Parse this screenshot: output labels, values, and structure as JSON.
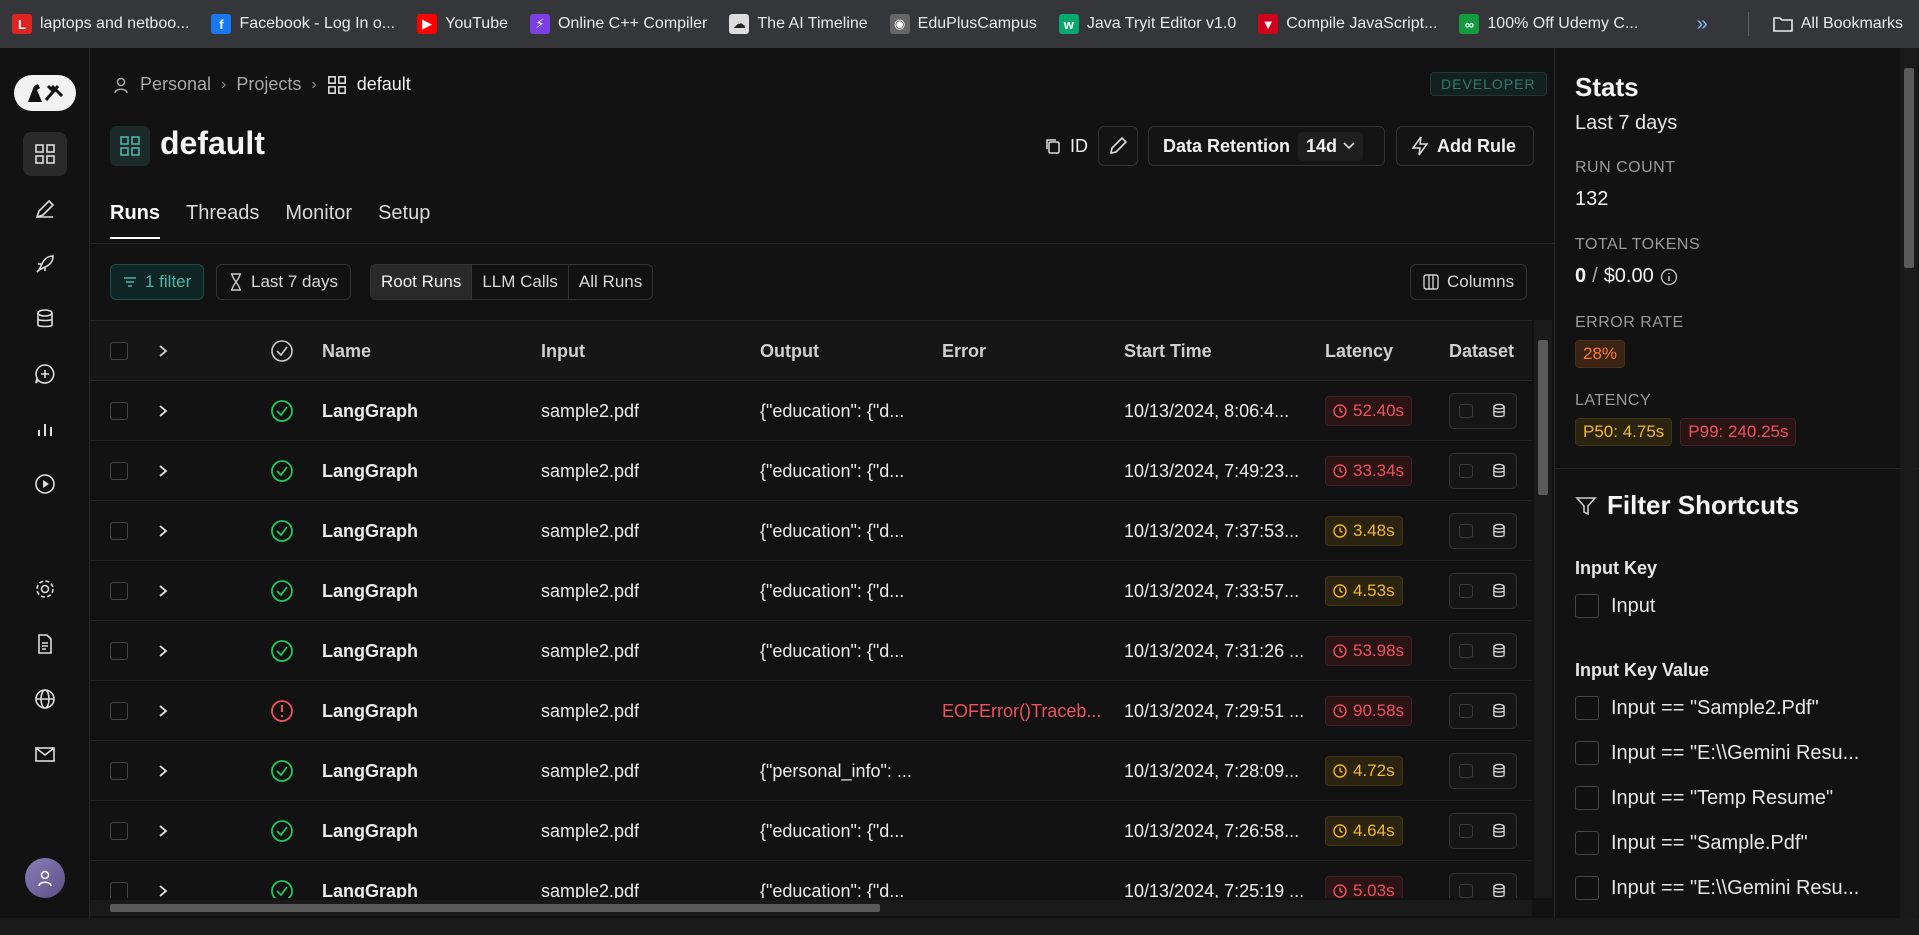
{
  "bookmarks": [
    {
      "label": "laptops and netboo...",
      "color": "#e02424",
      "glyph": "L"
    },
    {
      "label": "Facebook - Log In o...",
      "color": "#1877f2",
      "glyph": "f"
    },
    {
      "label": "YouTube",
      "color": "#ff0000",
      "glyph": "▶"
    },
    {
      "label": "Online C++ Compiler",
      "color": "#7b3fe4",
      "glyph": "⚡"
    },
    {
      "label": "The AI Timeline",
      "color": "#dddddd",
      "glyph": "☁"
    },
    {
      "label": "EduPlusCampus",
      "color": "#666666",
      "glyph": "◉"
    },
    {
      "label": "Java Tryit Editor v1.0",
      "color": "#04aa6d",
      "glyph": "w"
    },
    {
      "label": "Compile JavaScript...",
      "color": "#d0021b",
      "glyph": "▼"
    },
    {
      "label": "100% Off Udemy C...",
      "color": "#129c3e",
      "glyph": "∞"
    }
  ],
  "bookmarks_more": "»",
  "all_bookmarks": "All Bookmarks",
  "breadcrumb": {
    "personal": "Personal",
    "projects": "Projects",
    "current": "default"
  },
  "env_badge": "DEVELOPER",
  "project": {
    "title": "default"
  },
  "toolbar": {
    "id_label": "ID",
    "retention_label": "Data Retention",
    "retention_value": "14d",
    "add_rule": "Add Rule"
  },
  "tabs": [
    {
      "label": "Runs",
      "active": true
    },
    {
      "label": "Threads",
      "active": false
    },
    {
      "label": "Monitor",
      "active": false
    },
    {
      "label": "Setup",
      "active": false
    }
  ],
  "filters": {
    "filter_count": "1 filter",
    "date_range": "Last 7 days",
    "run_types": [
      "Root Runs",
      "LLM Calls",
      "All Runs"
    ],
    "selected_type": "Root Runs",
    "columns": "Columns"
  },
  "table": {
    "headers": [
      "Name",
      "Input",
      "Output",
      "Error",
      "Start Time",
      "Latency",
      "Dataset"
    ],
    "rows": [
      {
        "status": "success",
        "name": "LangGraph",
        "input": "sample2.pdf",
        "output": "{\"education\": {\"d...",
        "error": "",
        "start": "10/13/2024, 8:06:4...",
        "latency": "52.40s",
        "lat_level": "red"
      },
      {
        "status": "success",
        "name": "LangGraph",
        "input": "sample2.pdf",
        "output": "{\"education\": {\"d...",
        "error": "",
        "start": "10/13/2024, 7:49:23...",
        "latency": "33.34s",
        "lat_level": "red"
      },
      {
        "status": "success",
        "name": "LangGraph",
        "input": "sample2.pdf",
        "output": "{\"education\": {\"d...",
        "error": "",
        "start": "10/13/2024, 7:37:53...",
        "latency": "3.48s",
        "lat_level": "yel"
      },
      {
        "status": "success",
        "name": "LangGraph",
        "input": "sample2.pdf",
        "output": "{\"education\": {\"d...",
        "error": "",
        "start": "10/13/2024, 7:33:57...",
        "latency": "4.53s",
        "lat_level": "yel"
      },
      {
        "status": "success",
        "name": "LangGraph",
        "input": "sample2.pdf",
        "output": "{\"education\": {\"d...",
        "error": "",
        "start": "10/13/2024, 7:31:26 ...",
        "latency": "53.98s",
        "lat_level": "red"
      },
      {
        "status": "error",
        "name": "LangGraph",
        "input": "sample2.pdf",
        "output": "",
        "error": "EOFError()Traceb...",
        "start": "10/13/2024, 7:29:51 ...",
        "latency": "90.58s",
        "lat_level": "red"
      },
      {
        "status": "success",
        "name": "LangGraph",
        "input": "sample2.pdf",
        "output": "{\"personal_info\": ...",
        "error": "",
        "start": "10/13/2024, 7:28:09...",
        "latency": "4.72s",
        "lat_level": "yel"
      },
      {
        "status": "success",
        "name": "LangGraph",
        "input": "sample2.pdf",
        "output": "{\"education\": {\"d...",
        "error": "",
        "start": "10/13/2024, 7:26:58...",
        "latency": "4.64s",
        "lat_level": "yel"
      },
      {
        "status": "success",
        "name": "LangGraph",
        "input": "sample2.pdf",
        "output": "{\"education\": {\"d...",
        "error": "",
        "start": "10/13/2024, 7:25:19 ...",
        "latency": "5.03s",
        "lat_level": "red"
      }
    ]
  },
  "stats": {
    "title": "Stats",
    "period": "Last 7 days",
    "run_count_label": "RUN COUNT",
    "run_count": "132",
    "total_tokens_label": "TOTAL TOKENS",
    "tokens": "0",
    "cost": "$0.00",
    "error_rate_label": "ERROR RATE",
    "error_rate": "28%",
    "latency_label": "LATENCY",
    "p50": "P50: 4.75s",
    "p99": "P99: 240.25s"
  },
  "filter_shortcuts": {
    "title": "Filter Shortcuts",
    "input_key_label": "Input Key",
    "input_key_items": [
      "Input"
    ],
    "input_key_value_label": "Input Key Value",
    "input_key_value_items": [
      "Input == \"Sample2.Pdf\"",
      "Input == \"E:\\\\Gemini Resu...",
      "Input == \"Temp Resume\"",
      "Input == \"Sample.Pdf\"",
      "Input == \"E:\\\\Gemini Resu..."
    ]
  },
  "colors": {
    "accent": "#4fb3a5",
    "error": "#f0515e",
    "warning": "#f2b72f",
    "success": "#22c55e"
  }
}
